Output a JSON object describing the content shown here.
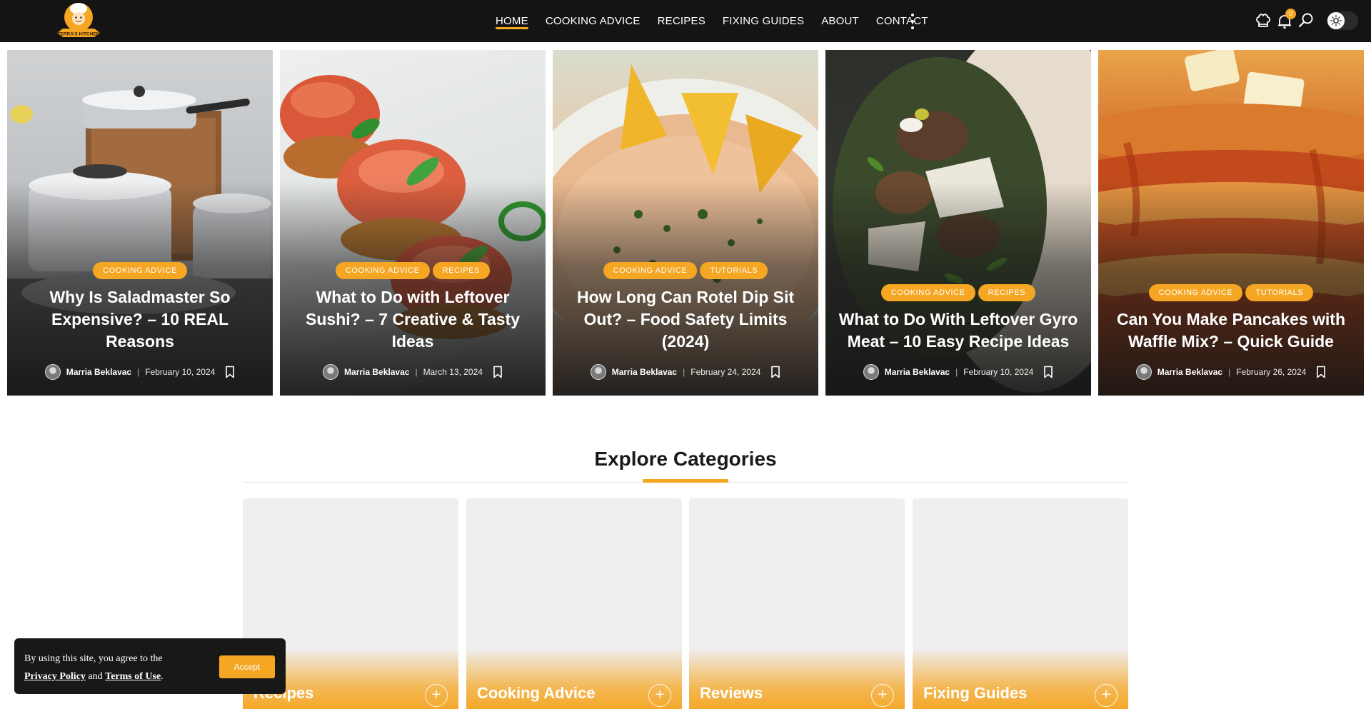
{
  "site": {
    "logo_text": "TERRA'S KITCHEN"
  },
  "nav": {
    "items": [
      {
        "label": "HOME",
        "active": true
      },
      {
        "label": "COOKING ADVICE",
        "active": false
      },
      {
        "label": "RECIPES",
        "active": false
      },
      {
        "label": "FIXING GUIDES",
        "active": false
      },
      {
        "label": "ABOUT",
        "active": false
      },
      {
        "label": "CONTACT",
        "active": false
      }
    ],
    "more_icon": "more-vertical-icon",
    "icons": [
      "chef-hat-icon",
      "bell-icon",
      "search-icon",
      "sun-icon"
    ],
    "notification_count": "0"
  },
  "featured": [
    {
      "tags": [
        "COOKING ADVICE"
      ],
      "title": "Why Is Saladmaster So Expensive? – 10 REAL Reasons",
      "author": "Marria Beklavac",
      "date": "February 10, 2024"
    },
    {
      "tags": [
        "COOKING ADVICE",
        "RECIPES"
      ],
      "title": "What to Do with Leftover Sushi? – 7 Creative & Tasty Ideas",
      "author": "Marria Beklavac",
      "date": "March 13, 2024"
    },
    {
      "tags": [
        "COOKING ADVICE",
        "TUTORIALS"
      ],
      "title": "How Long Can Rotel Dip Sit Out? – Food Safety Limits (2024)",
      "author": "Marria Beklavac",
      "date": "February 24, 2024"
    },
    {
      "tags": [
        "COOKING ADVICE",
        "RECIPES"
      ],
      "title": "What to Do With Leftover Gyro Meat – 10 Easy Recipe Ideas",
      "author": "Marria Beklavac",
      "date": "February 10, 2024"
    },
    {
      "tags": [
        "COOKING ADVICE",
        "TUTORIALS"
      ],
      "title": "Can You Make Pancakes with Waffle Mix? – Quick Guide",
      "author": "Marria Beklavac",
      "date": "February 26, 2024"
    }
  ],
  "categories": {
    "title": "Explore Categories",
    "items": [
      {
        "name": "Recipes"
      },
      {
        "name": "Cooking Advice"
      },
      {
        "name": "Reviews"
      },
      {
        "name": "Fixing Guides"
      }
    ]
  },
  "cookie": {
    "text_before": "By using this site, you agree to the",
    "privacy_label": "Privacy Policy",
    "and_label": "and",
    "terms_label": "Terms of Use",
    "period": ".",
    "accept_label": "Accept"
  },
  "colors": {
    "accent": "#f5a623",
    "header_bg": "#141414"
  }
}
